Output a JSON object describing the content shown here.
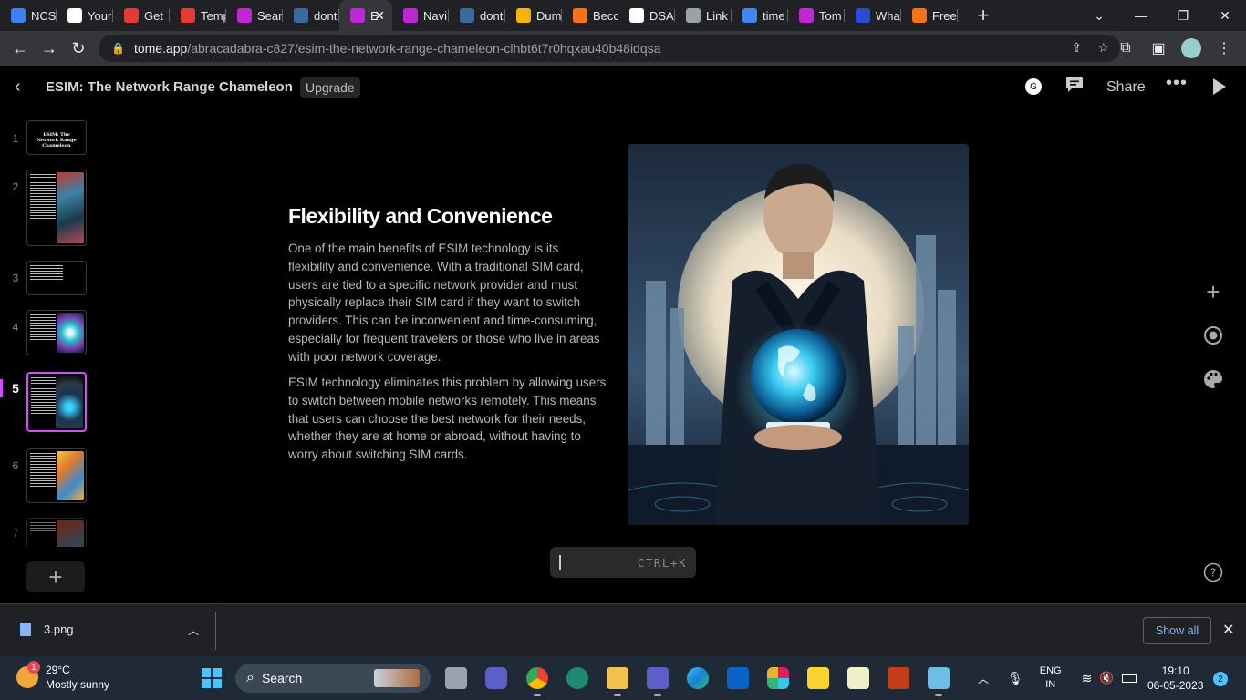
{
  "browser": {
    "tabs": [
      {
        "label": "NCS",
        "icon": "ncs-icon",
        "color": "#3b82f6"
      },
      {
        "label": "Your",
        "icon": "si-icon",
        "color": "#ffffff"
      },
      {
        "label": "Get",
        "icon": "get-icon",
        "color": "#e53935"
      },
      {
        "label": "Temp",
        "icon": "mail-icon",
        "color": "#e53935"
      },
      {
        "label": "Sear",
        "icon": "tome-icon",
        "color": "#c026d3"
      },
      {
        "label": "dont",
        "icon": "pt-icon",
        "color": "#3b6aa0"
      },
      {
        "label": "E",
        "icon": "tome-icon",
        "color": "#c026d3",
        "active": true
      },
      {
        "label": "Navi",
        "icon": "tome-icon",
        "color": "#c026d3"
      },
      {
        "label": "dont",
        "icon": "pt-icon",
        "color": "#3b6aa0"
      },
      {
        "label": "Dum",
        "icon": "crown-icon",
        "color": "#f5b400"
      },
      {
        "label": "Becc",
        "icon": "becc-icon",
        "color": "#f97316"
      },
      {
        "label": "DSA",
        "icon": "github-icon",
        "color": "#ffffff"
      },
      {
        "label": "Link",
        "icon": "globe-icon",
        "color": "#9aa0a6"
      },
      {
        "label": "time",
        "icon": "google-icon",
        "color": "#4285f4"
      },
      {
        "label": "Tom",
        "icon": "tome-icon",
        "color": "#c026d3"
      },
      {
        "label": "Wha",
        "icon": "wha-icon",
        "color": "#2b4ad8"
      },
      {
        "label": "Free",
        "icon": "free-icon",
        "color": "#f97316"
      }
    ],
    "url_host": "tome.app",
    "url_path": "/abracadabra-c827/esim-the-network-range-chameleon-clhbt6t7r0hqxau40b48idqsa"
  },
  "app": {
    "title": "ESIM: The Network Range Chameleon",
    "upgrade_label": "Upgrade",
    "avatar_letter": "G",
    "share_label": "Share",
    "cmdk_hint": "CTRL+K"
  },
  "thumbnails": [
    {
      "num": "1",
      "title": "ESIM: The Network Range Chameleon"
    },
    {
      "num": "2"
    },
    {
      "num": "3"
    },
    {
      "num": "4"
    },
    {
      "num": "5",
      "active": true
    },
    {
      "num": "6"
    },
    {
      "num": "7"
    }
  ],
  "slide": {
    "heading": "Flexibility and Convenience",
    "paragraph1": "One of the main benefits of ESIM technology is its flexibility and convenience. With a traditional SIM card, users are tied to a specific network provider and must physically replace their SIM card if they want to switch providers. This can be inconvenient and time-consuming, especially for frequent travelers or those who live in areas with poor network coverage.",
    "paragraph2": "ESIM technology eliminates this problem by allowing users to switch between mobile networks remotely. This means that users can choose the best network for their needs, whether they are at home or abroad, without having to worry about switching SIM cards."
  },
  "download": {
    "filename": "3.png",
    "show_all_label": "Show all"
  },
  "taskbar": {
    "weather_temp": "29°C",
    "weather_desc": "Mostly sunny",
    "weather_badge": "1",
    "search_label": "Search",
    "lang1": "ENG",
    "lang2": "IN",
    "time": "19:10",
    "date": "06-05-2023",
    "notif_count": "2"
  }
}
